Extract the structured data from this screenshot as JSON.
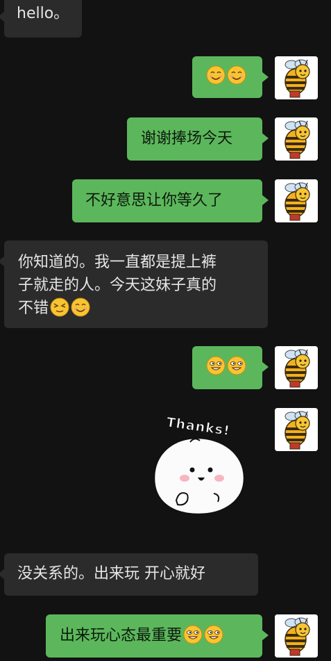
{
  "messages": [
    {
      "side": "in",
      "text": "hello。"
    },
    {
      "side": "out",
      "text": ""
    },
    {
      "side": "out",
      "text": "谢谢捧场今天"
    },
    {
      "side": "out",
      "text": "不好意思让你等久了"
    },
    {
      "side": "in",
      "lines": [
        "你知道的。我一直都是提上裤",
        "子就走的人。今天这妹子真的",
        "不错"
      ]
    },
    {
      "side": "out",
      "text": ""
    },
    {
      "side": "out",
      "sticker_text": "Thanks!"
    },
    {
      "side": "in",
      "text": "没关系的。出来玩 开心就好"
    },
    {
      "side": "out",
      "text": "出来玩心态最重要"
    }
  ],
  "colors": {
    "background": "#121212",
    "outgoing": "#5cb75c",
    "incoming": "#2b2b2b"
  },
  "icons": [
    "bee-avatar-icon",
    "smile-emoji-icon",
    "squint-emoji-icon",
    "grin-emoji-icon",
    "thanks-sticker-icon"
  ]
}
